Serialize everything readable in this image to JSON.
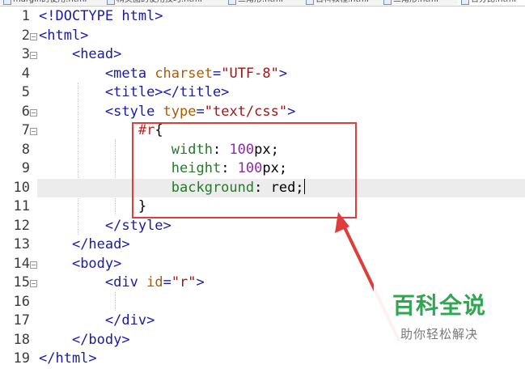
{
  "tabs": [
    {
      "label": "margin的使用.html"
    },
    {
      "label": "精灵图的使用技巧.html"
    },
    {
      "label": "三角形.html"
    },
    {
      "label": "百科教程.html"
    },
    {
      "label": "三角形.html"
    },
    {
      "label": "百分比.html"
    }
  ],
  "editor": {
    "current_line": 10,
    "lines": [
      {
        "n": "1",
        "fold": false,
        "segs": [
          {
            "c": "tag",
            "t": "<!DOCTYPE html>"
          }
        ]
      },
      {
        "n": "2",
        "fold": true,
        "segs": [
          {
            "c": "tag",
            "t": "<html>"
          }
        ]
      },
      {
        "n": "3",
        "fold": true,
        "segs": [
          {
            "c": "",
            "t": "    "
          },
          {
            "c": "tag",
            "t": "<head>"
          }
        ]
      },
      {
        "n": "4",
        "fold": false,
        "segs": [
          {
            "c": "",
            "t": "        "
          },
          {
            "c": "tag",
            "t": "<meta "
          },
          {
            "c": "attr",
            "t": "charset"
          },
          {
            "c": "tag",
            "t": "="
          },
          {
            "c": "str",
            "t": "\"UTF-8\""
          },
          {
            "c": "tag",
            "t": ">"
          }
        ]
      },
      {
        "n": "5",
        "fold": false,
        "segs": [
          {
            "c": "",
            "t": "        "
          },
          {
            "c": "tag",
            "t": "<title></title>"
          }
        ]
      },
      {
        "n": "6",
        "fold": true,
        "segs": [
          {
            "c": "",
            "t": "        "
          },
          {
            "c": "tag",
            "t": "<style "
          },
          {
            "c": "attr",
            "t": "type"
          },
          {
            "c": "tag",
            "t": "="
          },
          {
            "c": "str",
            "t": "\"text/css\""
          },
          {
            "c": "tag",
            "t": ">"
          }
        ]
      },
      {
        "n": "7",
        "fold": true,
        "segs": [
          {
            "c": "",
            "t": "            "
          },
          {
            "c": "sel",
            "t": "#r"
          },
          {
            "c": "",
            "t": "{"
          }
        ]
      },
      {
        "n": "8",
        "fold": false,
        "segs": [
          {
            "c": "",
            "t": "                "
          },
          {
            "c": "prop",
            "t": "width"
          },
          {
            "c": "",
            "t": ": "
          },
          {
            "c": "val",
            "t": "100"
          },
          {
            "c": "",
            "t": "px;"
          }
        ]
      },
      {
        "n": "9",
        "fold": false,
        "segs": [
          {
            "c": "",
            "t": "                "
          },
          {
            "c": "prop",
            "t": "height"
          },
          {
            "c": "",
            "t": ": "
          },
          {
            "c": "val",
            "t": "100"
          },
          {
            "c": "",
            "t": "px;"
          }
        ]
      },
      {
        "n": "10",
        "fold": false,
        "segs": [
          {
            "c": "",
            "t": "                "
          },
          {
            "c": "prop",
            "t": "background"
          },
          {
            "c": "",
            "t": ": red;"
          }
        ]
      },
      {
        "n": "11",
        "fold": false,
        "segs": [
          {
            "c": "",
            "t": "            "
          },
          {
            "c": "",
            "t": "}"
          }
        ]
      },
      {
        "n": "12",
        "fold": false,
        "segs": [
          {
            "c": "",
            "t": "        "
          },
          {
            "c": "tag",
            "t": "</style>"
          }
        ]
      },
      {
        "n": "13",
        "fold": false,
        "segs": [
          {
            "c": "",
            "t": "    "
          },
          {
            "c": "tag",
            "t": "</head>"
          }
        ]
      },
      {
        "n": "14",
        "fold": true,
        "segs": [
          {
            "c": "",
            "t": "    "
          },
          {
            "c": "tag",
            "t": "<body>"
          }
        ]
      },
      {
        "n": "15",
        "fold": true,
        "segs": [
          {
            "c": "",
            "t": "        "
          },
          {
            "c": "tag",
            "t": "<div "
          },
          {
            "c": "attr",
            "t": "id"
          },
          {
            "c": "tag",
            "t": "="
          },
          {
            "c": "str",
            "t": "\"r\""
          },
          {
            "c": "tag",
            "t": ">"
          }
        ]
      },
      {
        "n": "16",
        "fold": false,
        "segs": []
      },
      {
        "n": "17",
        "fold": false,
        "segs": [
          {
            "c": "",
            "t": "        "
          },
          {
            "c": "tag",
            "t": "</div>"
          }
        ]
      },
      {
        "n": "18",
        "fold": false,
        "segs": [
          {
            "c": "",
            "t": "    "
          },
          {
            "c": "tag",
            "t": "</body>"
          }
        ]
      },
      {
        "n": "19",
        "fold": false,
        "segs": [
          {
            "c": "tag",
            "t": "</html>"
          }
        ]
      }
    ]
  },
  "annotation": {
    "color": "#e23b3b"
  },
  "watermark": {
    "title": "百科全说",
    "subtitle": "助你轻松解决"
  },
  "colors": {
    "tag": "#1a1aa6",
    "attribute": "#b05a00",
    "string": "#a31515",
    "selector": "#d41b1b",
    "property": "#267a2a",
    "number": "#8e2ba8",
    "current_line_bg": "#ececec"
  }
}
